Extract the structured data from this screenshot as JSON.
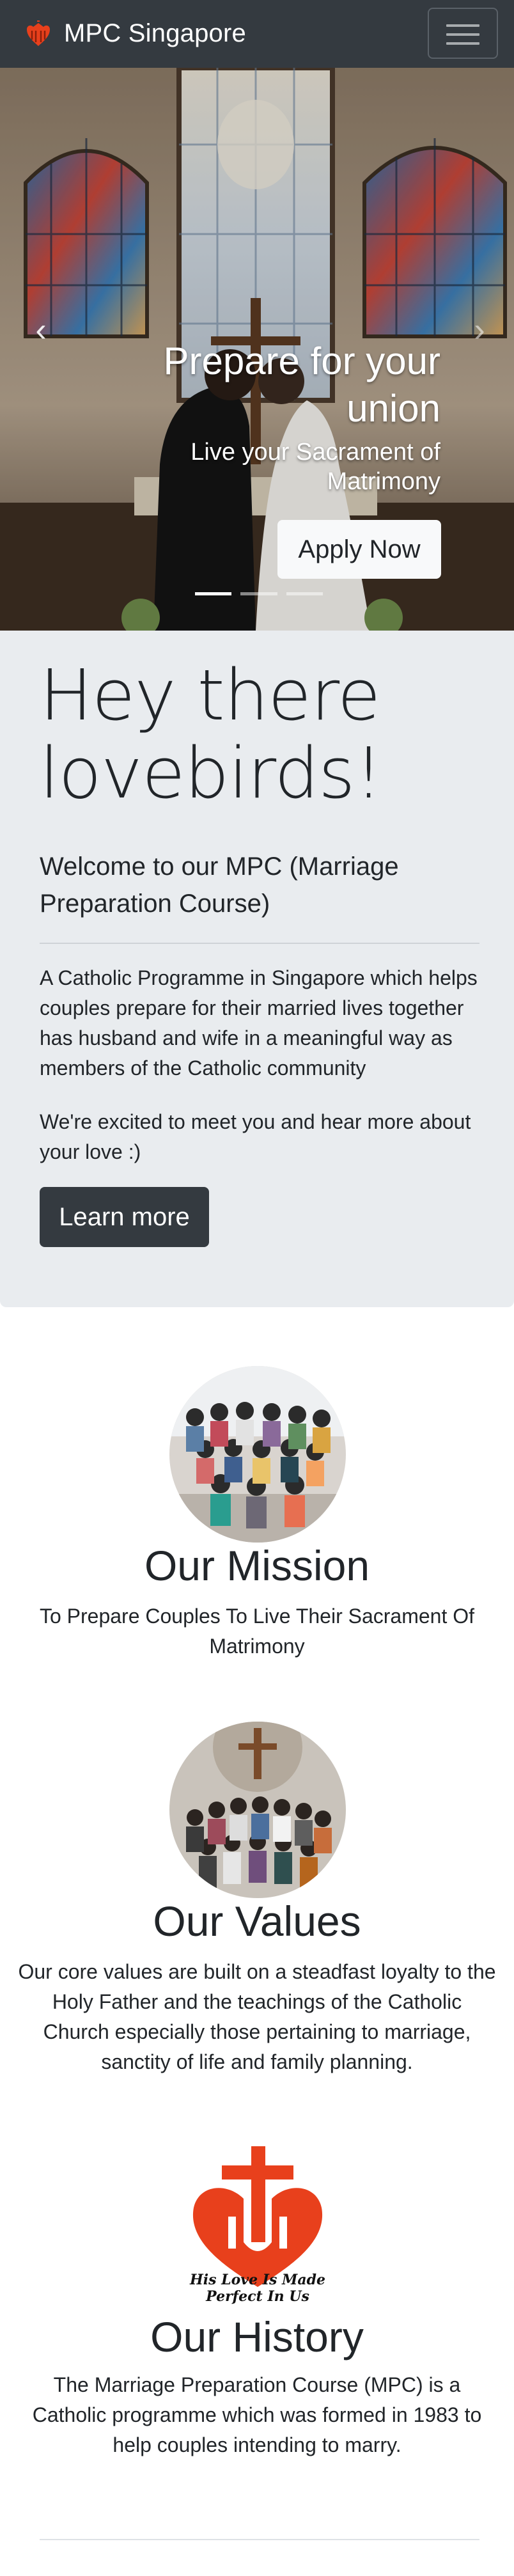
{
  "navbar": {
    "brand": "MPC Singapore",
    "logo_icon": "church-logo-icon",
    "toggler_icon": "hamburger-menu-icon"
  },
  "carousel": {
    "title": "Prepare for your union",
    "subtitle": "Live your Sacrament of Matrimony",
    "button_label": "Apply Now",
    "prev_icon": "chevron-left-icon",
    "next_icon": "chevron-right-icon",
    "indicators": [
      {
        "active": true
      },
      {
        "active": false
      },
      {
        "active": false
      }
    ]
  },
  "jumbotron": {
    "title": "Hey there lovebirds!",
    "lead": "Welcome to our MPC (Marriage Preparation Course)",
    "paragraph1": "A Catholic Programme in Singapore which helps couples prepare for their married lives together has husband and wife in a meaningful way as members of the Catholic community",
    "paragraph2": "We're excited to meet you and hear more about your love :)",
    "button_label": "Learn more"
  },
  "sections": {
    "mission": {
      "title": "Our Mission",
      "text": "To Prepare Couples To Live Their Sacrament Of Matrimony"
    },
    "values": {
      "title": "Our Values",
      "text": "Our core values are built on a steadfast loyalty to the Holy Father and the teachings of the Catholic Church especially those pertaining to marriage, sanctity of life and family planning."
    },
    "history": {
      "title": "Our History",
      "text": "The Marriage Preparation Course (MPC) is a Catholic programme which was formed in 1983 to help couples intending to marry.",
      "logo_tagline": "His Love Is Made Perfect In Us"
    }
  },
  "colors": {
    "navbar_bg": "#343a40",
    "jumbotron_bg": "#e9ecef",
    "logo_red": "#e8401c"
  }
}
